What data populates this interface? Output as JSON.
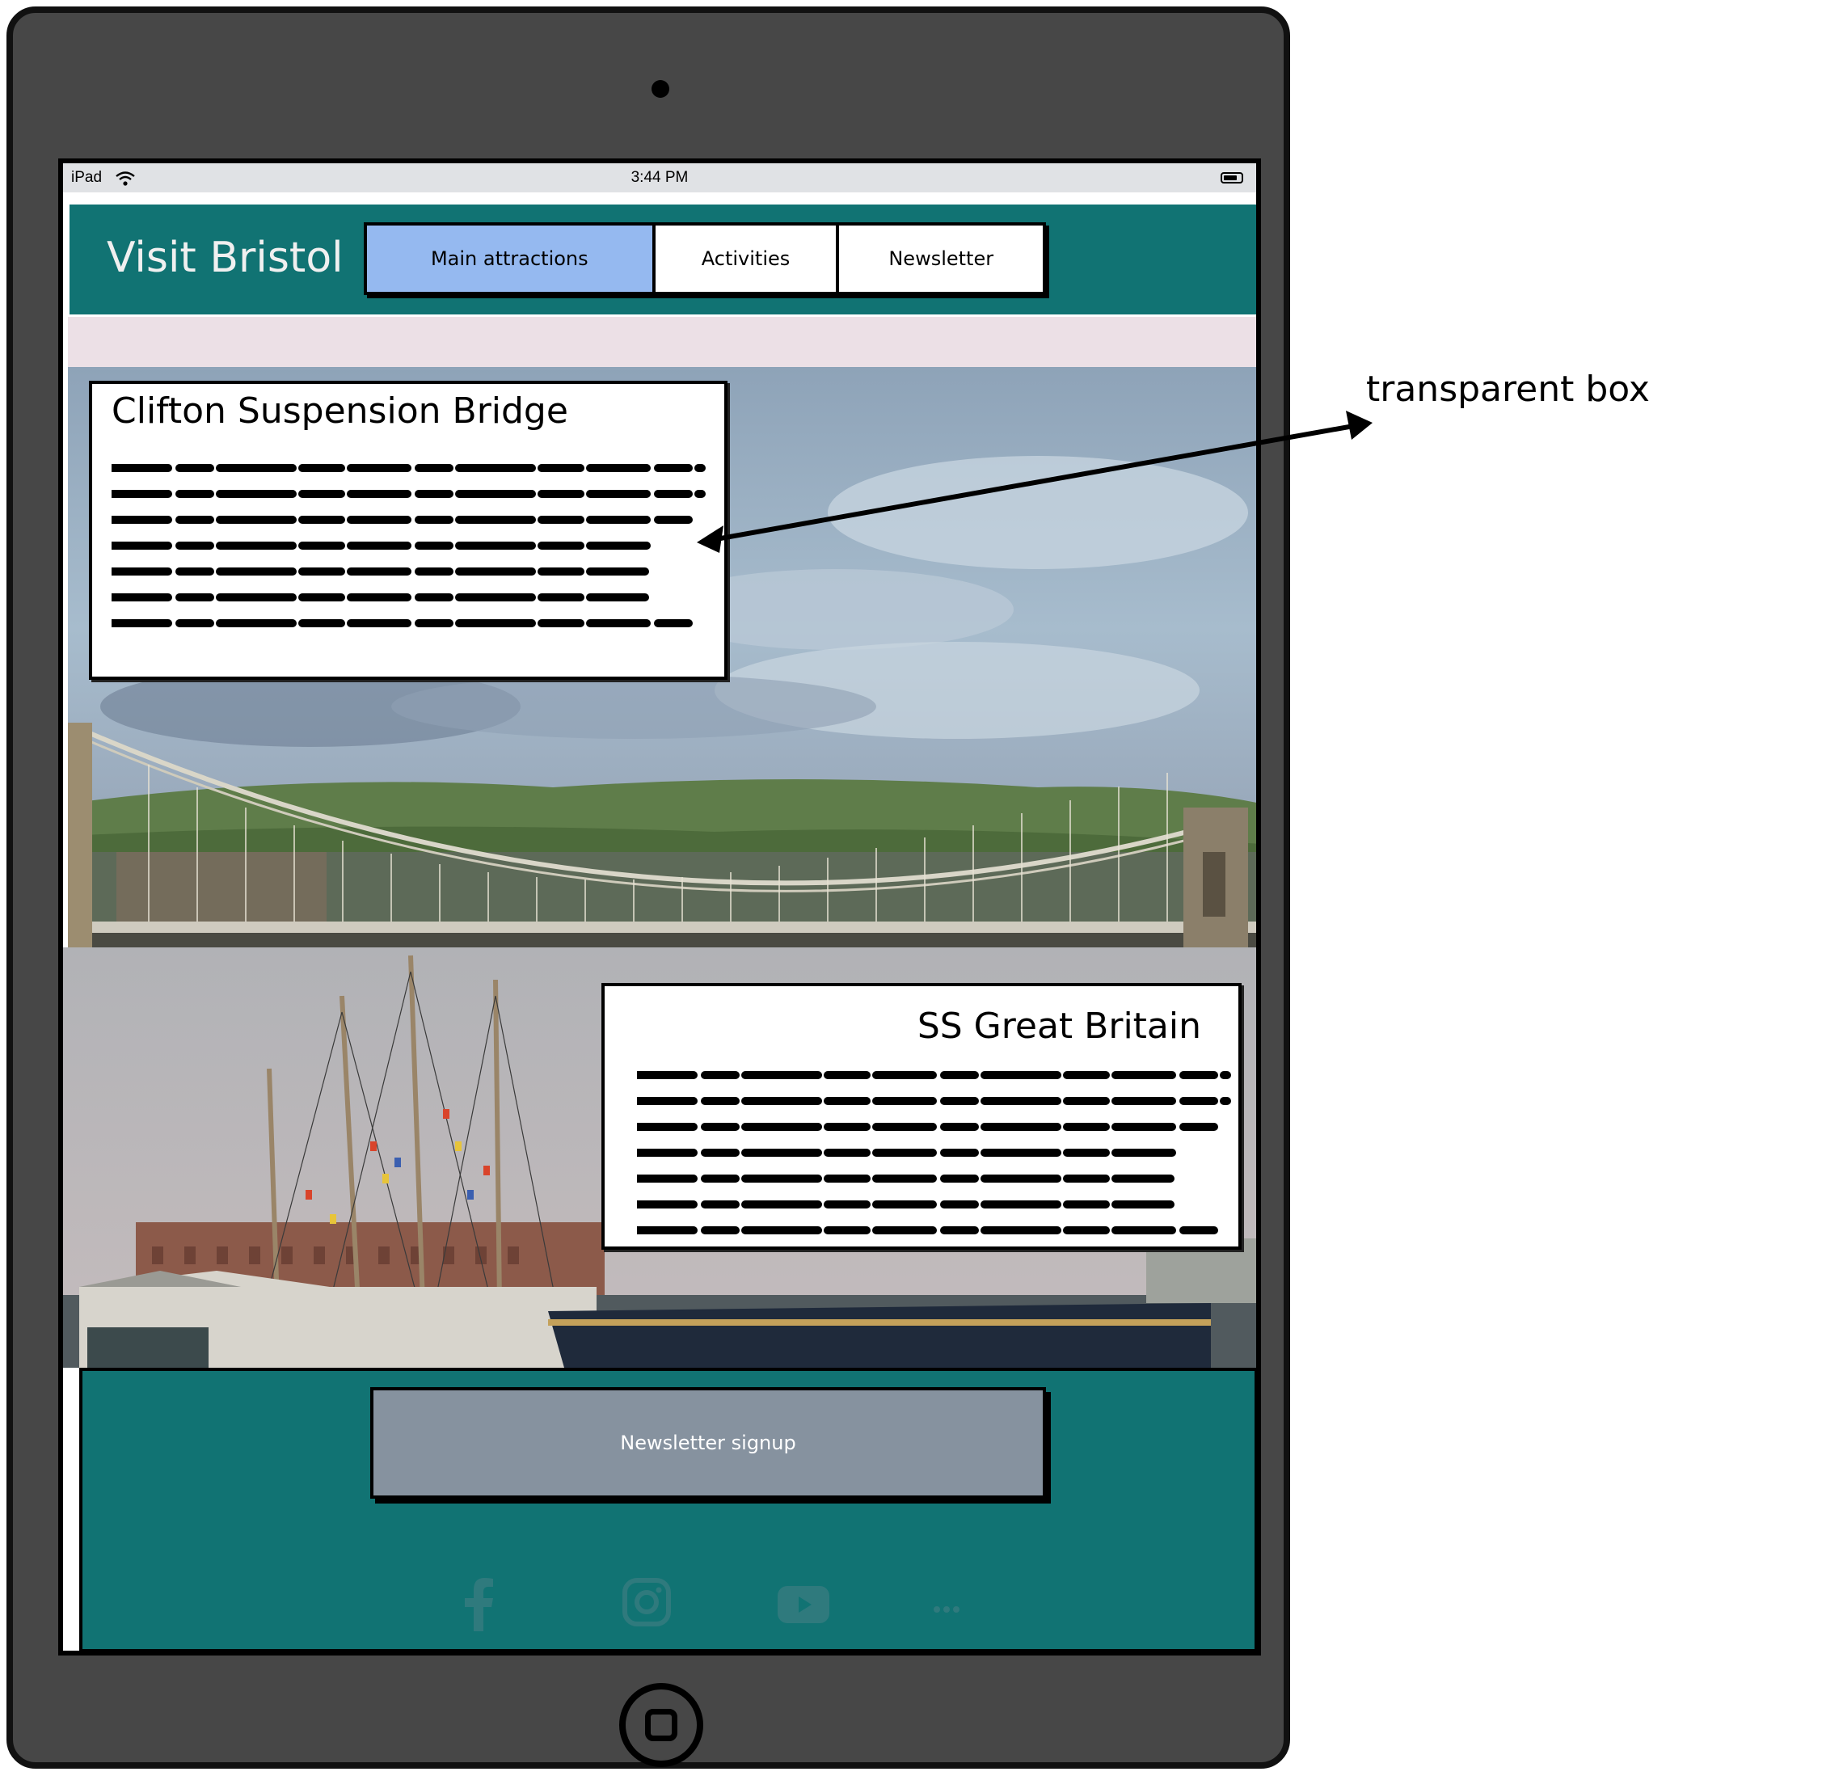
{
  "status_bar": {
    "device": "iPad",
    "time": "3:44 PM"
  },
  "header": {
    "title": "Visit Bristol",
    "nav": [
      "Main attractions",
      "Activities",
      "Newsletter"
    ],
    "active": "Main attractions"
  },
  "attractions": [
    {
      "title": "Clifton Suspension Bridge"
    },
    {
      "title": "SS Great Britain"
    }
  ],
  "footer": {
    "signup_label": "Newsletter signup",
    "social_icons": [
      "facebook-icon",
      "instagram-icon",
      "youtube-icon",
      "more-icon"
    ]
  },
  "annotation": {
    "label": "transparent box"
  },
  "colors": {
    "header_bg": "#117373",
    "nav_active": "#95b9f0",
    "pink_strip": "#ece0e6",
    "signup_bg": "#86929f",
    "frame": "#474747"
  }
}
